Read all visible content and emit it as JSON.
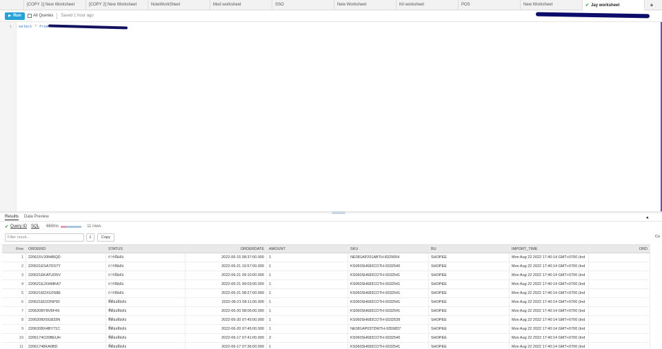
{
  "tabs": [
    {
      "label": "[COPY 1] New Worksheet",
      "active": false
    },
    {
      "label": "[COPY 2] New Worksheet",
      "active": false
    },
    {
      "label": "NoteWorkSheet",
      "active": false
    },
    {
      "label": "Mod worksheet",
      "active": false
    },
    {
      "label": "SSO",
      "active": false
    },
    {
      "label": "New Worksheet",
      "active": false
    },
    {
      "label": "Kit worksheet",
      "active": false
    },
    {
      "label": "POS",
      "active": false
    },
    {
      "label": "New Worksheet",
      "active": false
    },
    {
      "label": "Jay worksheet",
      "active": true
    }
  ],
  "tab_add_label": "+",
  "toolbar": {
    "run_label": "Run",
    "all_queries_label": "All Queries",
    "saved_label": "Saved 1 hour ago"
  },
  "editor": {
    "line_number": "1",
    "code_keyword1": "select",
    "code_operator": "*",
    "code_keyword2": "from"
  },
  "results_tabs": {
    "results_label": "Results",
    "data_preview_label": "Data Preview",
    "collapse_icon": "◂"
  },
  "query_info": {
    "query_id_label": "Query ID",
    "sql_label": "SQL",
    "duration": "660ms",
    "rows": "11 rows"
  },
  "filter": {
    "placeholder": "Filter result...",
    "copy_label": "Copy",
    "download_icon": "⤓",
    "co_label": "Co"
  },
  "table": {
    "columns": [
      "Row",
      "ORDERID",
      "STATUS",
      "ORDERDATE",
      "AMOUNT",
      "SKU",
      "BU",
      "IMPORT_TIME",
      "ORD"
    ],
    "rows": [
      [
        "1",
        "220615VJ0N4BQD",
        "การจัดส่ง",
        "2022-06-15 08:37:00.000",
        "1",
        "NE081AP201ABTH-8329054",
        "SHOPEE",
        "Mon Aug 22 2022 17:40:14 GMT+0700 (Ind",
        ""
      ],
      [
        "2",
        "220621ESA7DS7Y",
        "การจัดส่ง",
        "2022-06-21 10:57:00.000",
        "1",
        "KS060SH683COTH-9332540",
        "SHOPEE",
        "Mon Aug 22 2022 17:40:14 GMT+0700 (Ind",
        ""
      ],
      [
        "3",
        "220621EKATUD5V",
        "การจัดส่ง",
        "2022-06-21 09:10:00.000",
        "1",
        "KS060SH683COTH-9332541",
        "SHOPEE",
        "Mon Aug 22 2022 17:40:14 GMT+0700 (Ind",
        ""
      ],
      [
        "4",
        "220621EJXHMKA7",
        "การจัดส่ง",
        "2022-06-21 09:03:00.000",
        "1",
        "KS060SH683COTH-9332541",
        "SHOPEE",
        "Mon Aug 22 2022 17:40:14 GMT+0700 (Ind",
        ""
      ],
      [
        "5",
        "220621EDXU0S8E",
        "การจัดส่ง",
        "2022-06-21 08:27:00.000",
        "1",
        "KS060SH683COTH-9332541",
        "SHOPEE",
        "Mon Aug 22 2022 17:40:14 GMT+0700 (Ind",
        ""
      ],
      [
        "6",
        "220621ED22NP92",
        "ที่ต้องจัดส่ง",
        "2022-06-21 08:11:00.000",
        "1",
        "KS060SH683COTH-9332541",
        "SHOPEE",
        "Mon Aug 22 2022 17:40:14 GMT+0700 (Ind",
        ""
      ],
      [
        "7",
        "220620BY8V8F4S",
        "ที่ต้องจัดส่ง",
        "2022-06-20 08:05:00.000",
        "1",
        "KS060SH683COTH-9332541",
        "SHOPEE",
        "Mon Aug 22 2022 17:40:14 GMT+0700 (Ind",
        ""
      ],
      [
        "8",
        "220620BX5G833N",
        "ที่ต้องจัดส่ง",
        "2022-06-20 07:45:00.000",
        "1",
        "KS060SH683COTH-9332539",
        "SHOPEE",
        "Mon Aug 22 2022 17:40:14 GMT+0700 (Ind",
        ""
      ],
      [
        "9",
        "220620BX4BY71C",
        "ที่ต้องจัดส่ง",
        "2022-06-20 07:45:00.000",
        "1",
        "NE081AP03TDWTH-9359837",
        "SHOPEE",
        "Mon Aug 22 2022 17:40:14 GMT+0700 (Ind",
        ""
      ],
      [
        "10",
        "2206174C00BEUH",
        "ที่ต้องจัดส่ง",
        "2022-06-17 07:41:00.000",
        "2",
        "KS060SH683COTH-9332540",
        "SHOPEE",
        "Mon Aug 22 2022 17:40:14 GMT+0700 (Ind",
        ""
      ],
      [
        "11",
        "22061748KA0BD",
        "ที่ต้องจัดส่ง",
        "2022-06-17 07:36:00.000",
        "1",
        "KS060SH683COTH-9332541",
        "SHOPEE",
        "Mon Aug 22 2022 17:40:14 GMT+0700 (Ind",
        ""
      ]
    ]
  },
  "colors": {
    "run_button": "#29a0d8",
    "success": "#2a9d3a",
    "editor_border": "#8a3fb0"
  }
}
